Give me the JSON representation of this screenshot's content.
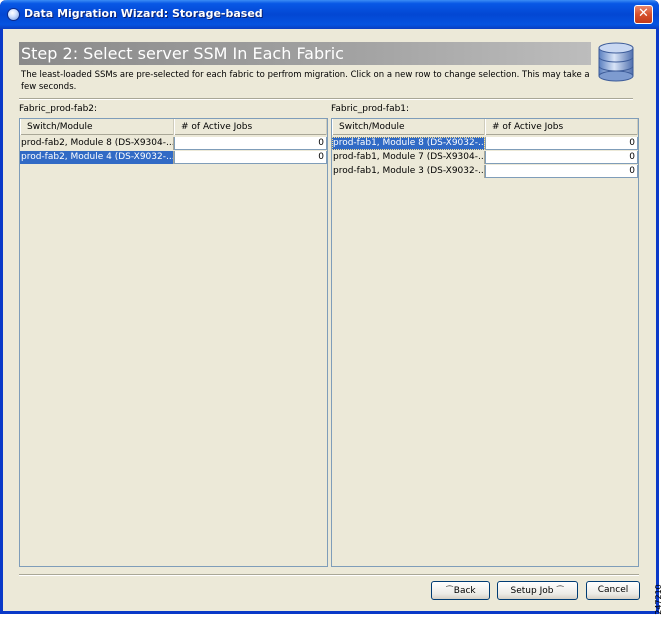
{
  "window": {
    "title": "Data Migration Wizard: Storage-based",
    "close_glyph": "✕"
  },
  "step": {
    "title": "Step 2: Select server SSM In Each Fabric",
    "description": "The least-loaded SSMs are pre-selected for each fabric to perfrom migration. Click on a new row to change selection. This may take a few seconds."
  },
  "left_panel": {
    "label": "Fabric_prod-fab2:",
    "columns": [
      "Switch/Module",
      "# of Active Jobs"
    ],
    "rows": [
      {
        "module": "prod-fab2, Module 8 (DS-X9304-...",
        "jobs": "0",
        "selected": false
      },
      {
        "module": "prod-fab2, Module 4 (DS-X9032-...",
        "jobs": "0",
        "selected": true
      }
    ]
  },
  "right_panel": {
    "label": "Fabric_prod-fab1:",
    "columns": [
      "Switch/Module",
      "# of Active Jobs"
    ],
    "rows": [
      {
        "module": "prod-fab1, Module 8 (DS-X9032-...",
        "jobs": "0",
        "selected": true
      },
      {
        "module": "prod-fab1, Module 7 (DS-X9304-...",
        "jobs": "0",
        "selected": false
      },
      {
        "module": "prod-fab1, Module 3 (DS-X9032-...",
        "jobs": "0",
        "selected": false
      }
    ]
  },
  "buttons": {
    "back": "Back",
    "setup_job": "Setup Job",
    "cancel": "Cancel"
  },
  "figure_number": "247210",
  "colors": {
    "titlebar": "#0347d3",
    "window_bg": "#ece9d8",
    "selection": "#316ac5",
    "banner": "#9a9a9a",
    "close_button": "#d6502b"
  },
  "icons": {
    "title": "app-orb-icon",
    "banner": "database-icon",
    "back": "back-arrow-icon",
    "setup": "next-arrow-icon"
  }
}
